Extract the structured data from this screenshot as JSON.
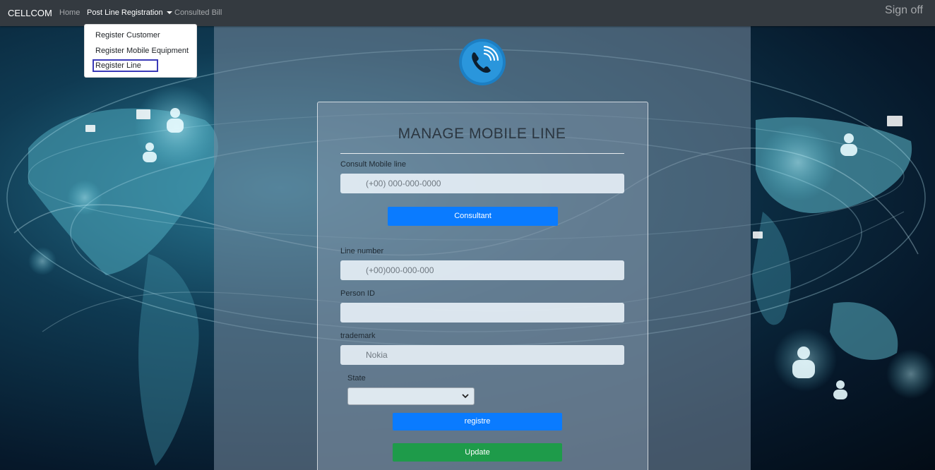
{
  "navbar": {
    "brand": "CELLCOM",
    "links": {
      "home": "Home",
      "post_line_registration": "Post Line Registration",
      "consulted_bill": "Consulted Bill"
    },
    "sign_off": "Sign off"
  },
  "dropdown": {
    "items": [
      "Register Customer",
      "Register Mobile Equipment",
      "Register Line"
    ],
    "selected": "Register Line"
  },
  "form": {
    "title": "MANAGE MOBILE LINE",
    "consult": {
      "label": "Consult Mobile line",
      "placeholder": "(+00) 000-000-0000",
      "button": "Consultant"
    },
    "line_number": {
      "label": "Line number",
      "placeholder": "(+00)000-000-000"
    },
    "person_id": {
      "label": "Person ID",
      "value": ""
    },
    "trademark": {
      "label": "trademark",
      "placeholder": "Nokia"
    },
    "state": {
      "label": "State",
      "selected": ""
    },
    "buttons": {
      "register": "registre",
      "update": "Update"
    }
  },
  "icons": {
    "logo": "phone-call-icon",
    "caret": "caret-down-icon",
    "select_chevron": "chevron-down-icon"
  },
  "colors": {
    "navbar": "#343a40",
    "primary_button": "#0a7bff",
    "success_button": "#1e9b4a",
    "logo_blue": "#1c7fc4"
  }
}
